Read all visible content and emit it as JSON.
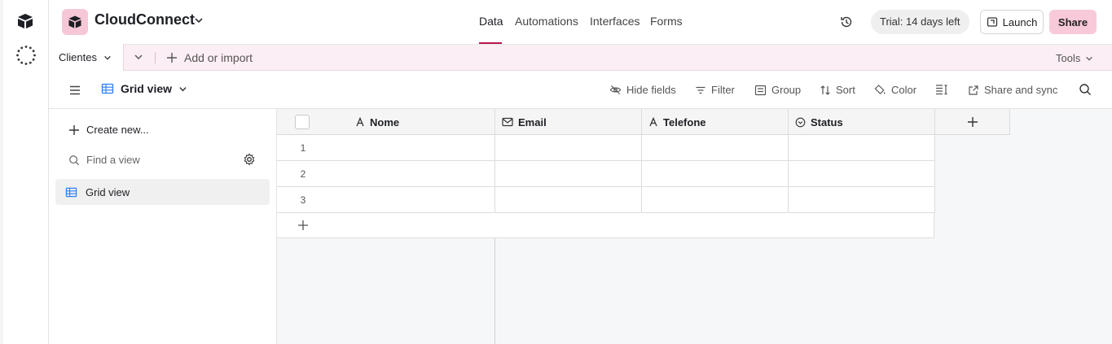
{
  "app": {
    "base_name": "CloudConnect",
    "brand_color": "#b8164a",
    "base_icon_bg": "#f6c7d6"
  },
  "header": {
    "tabs": [
      {
        "label": "Data",
        "active": true
      },
      {
        "label": "Automations",
        "active": false
      },
      {
        "label": "Interfaces",
        "active": false
      },
      {
        "label": "Forms",
        "active": false
      }
    ],
    "trial_label": "Trial: 14 days left",
    "launch_label": "Launch",
    "share_label": "Share"
  },
  "tablebar": {
    "active_table": "Clientes",
    "add_import_label": "Add or import",
    "tools_label": "Tools"
  },
  "viewbar": {
    "current_view": "Grid view",
    "tools": {
      "hide_fields": "Hide fields",
      "filter": "Filter",
      "group": "Group",
      "sort": "Sort",
      "color": "Color",
      "share_sync": "Share and sync"
    }
  },
  "views_sidebar": {
    "create_new_label": "Create new...",
    "find_placeholder": "Find a view",
    "views": [
      {
        "label": "Grid view",
        "icon": "grid-icon",
        "selected": true
      }
    ]
  },
  "grid": {
    "columns": [
      {
        "label": "Nome",
        "icon": "text-field-icon"
      },
      {
        "label": "Email",
        "icon": "email-field-icon"
      },
      {
        "label": "Telefone",
        "icon": "text-field-icon"
      },
      {
        "label": "Status",
        "icon": "single-select-icon"
      }
    ],
    "rows": [
      {
        "number": "1",
        "cells": [
          "",
          "",
          "",
          ""
        ]
      },
      {
        "number": "2",
        "cells": [
          "",
          "",
          "",
          ""
        ]
      },
      {
        "number": "3",
        "cells": [
          "",
          "",
          "",
          ""
        ]
      }
    ]
  }
}
